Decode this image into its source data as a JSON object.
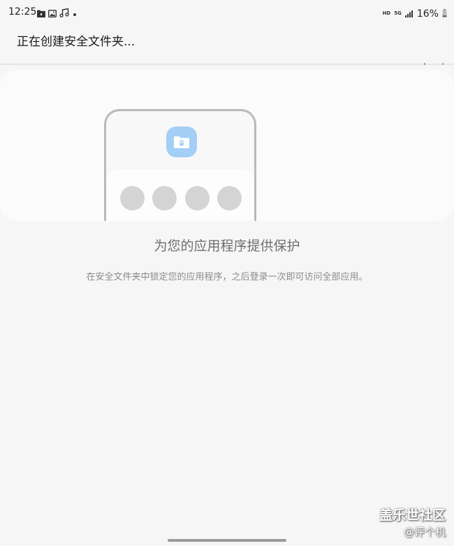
{
  "status_bar": {
    "time": "12:25",
    "left_icons": [
      "folder-icon",
      "image-icon",
      "music-icon",
      "dot-icon"
    ],
    "hd_label": "HD",
    "network_label": "5G",
    "battery": "16%"
  },
  "header": {
    "title": "正在创建安全文件夹..."
  },
  "illustration": {
    "badge_icon": "locked-folder-icon",
    "badge_color": "#a3cef5",
    "pin_dots": 4
  },
  "content": {
    "heading": "为您的应用程序提供保护",
    "description": "在安全文件夹中锁定您的应用程序，之后登录一次即可访问全部应用。"
  },
  "watermark": {
    "line1": "盖乐世社区",
    "line2": "@评个机"
  }
}
